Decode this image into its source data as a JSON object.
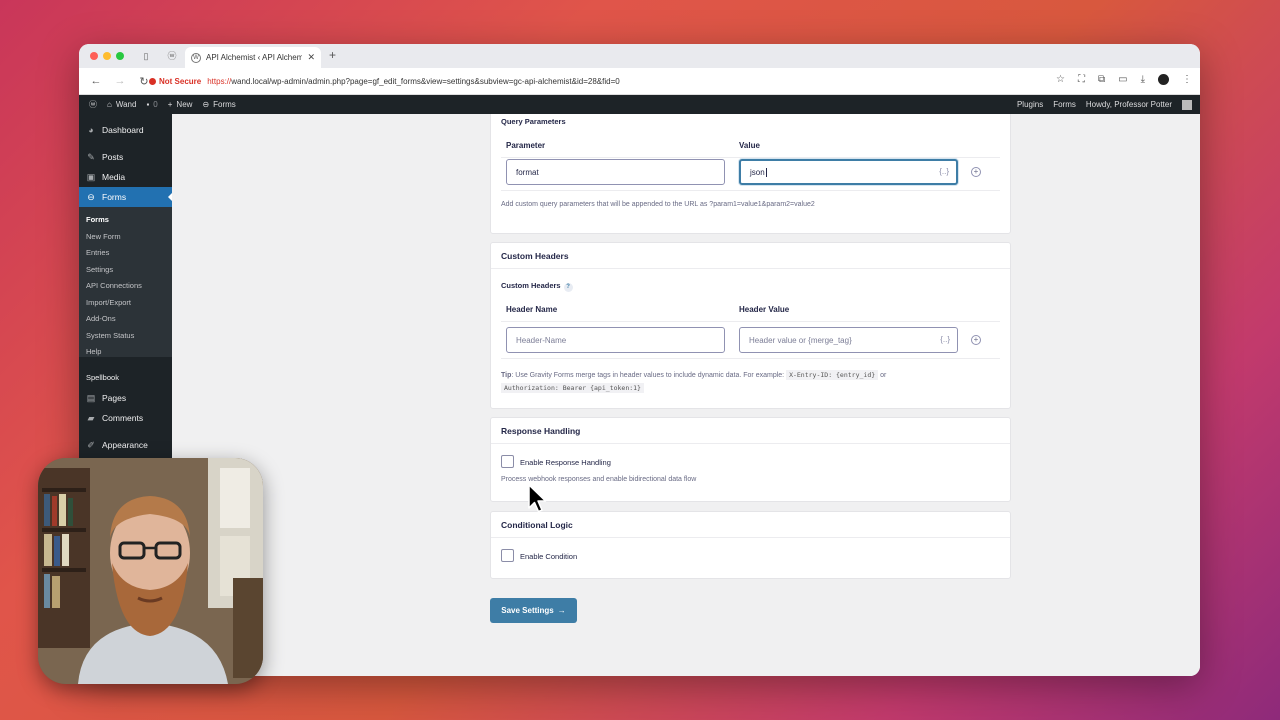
{
  "browser": {
    "tab_title": "API Alchemist ‹ API Alchemist",
    "not_secure": "Not Secure",
    "url_scheme": "https://",
    "url_rest": "wand.local/wp-admin/admin.php?page=gf_edit_forms&view=settings&subview=gc-api-alchemist&id=28&fid=0"
  },
  "adminbar": {
    "site": "Wand",
    "comments": "0",
    "new": "New",
    "forms": "Forms",
    "right": [
      "Plugins",
      "Forms",
      "Howdy, Professor Potter"
    ]
  },
  "sidebar": {
    "items": [
      {
        "label": "Dashboard",
        "icon": "dashboard-icon"
      },
      {
        "label": "Posts",
        "icon": "pin-icon"
      },
      {
        "label": "Media",
        "icon": "media-icon"
      },
      {
        "label": "Forms",
        "icon": "forms-icon"
      }
    ],
    "submenu": [
      "Forms",
      "New Form",
      "Entries",
      "Settings",
      "API Connections",
      "Import/Export",
      "Add-Ons",
      "System Status",
      "Help"
    ],
    "lower": [
      {
        "label": "Spellbook"
      },
      {
        "label": "Pages",
        "icon": "pages-icon"
      },
      {
        "label": "Comments",
        "icon": "comment-icon"
      },
      {
        "label": "Appearance",
        "icon": "brush-icon"
      }
    ]
  },
  "query_params": {
    "section_label": "Query Parameters",
    "col_param": "Parameter",
    "col_value": "Value",
    "param_value": "format",
    "value_value": "json",
    "help": "Add custom query parameters that will be appended to the URL as ?param1=value1&param2=value2"
  },
  "custom_headers": {
    "title": "Custom Headers",
    "label": "Custom Headers",
    "help_q": "?",
    "col_name": "Header Name",
    "col_value": "Header Value",
    "name_placeholder": "Header-Name",
    "value_placeholder": "Header value or {merge_tag}",
    "tip_label": "Tip",
    "tip_text": ": Use Gravity Forms merge tags in header values to include dynamic data. For example: ",
    "tip_code1": "X-Entry-ID: {entry_id}",
    "tip_or": " or",
    "tip_code2": "Authorization: Bearer {api_token:1}"
  },
  "response_handling": {
    "title": "Response Handling",
    "checkbox_label": "Enable Response Handling",
    "help": "Process webhook responses and enable bidirectional data flow"
  },
  "conditional_logic": {
    "title": "Conditional Logic",
    "checkbox_label": "Enable Condition"
  },
  "save_button": "Save Settings",
  "save_arrow": "→",
  "merge_icon": "{..}",
  "add_icon": "+"
}
